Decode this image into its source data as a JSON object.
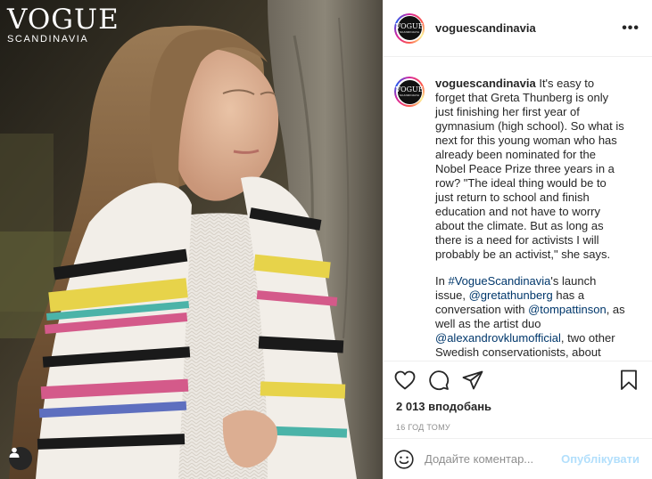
{
  "photo": {
    "logo": {
      "word": "VOGUE",
      "sub": "SCANDINAVIA"
    },
    "user_tag_icon": "user-silhouette-icon"
  },
  "header": {
    "username": "voguescandinavia",
    "more_icon": "ellipsis-icon",
    "more_label": "•••",
    "avatar": {
      "big": "VOGUE",
      "small": "SCANDINAVIA"
    }
  },
  "caption": {
    "username": "voguescandinavia",
    "paragraph1": " It's easy to forget that Greta Thunberg is only just finishing her first year of gymnasium (high school). So what is next for this young woman who has already been nominated for the Nobel Peace Prize three years in a row? \"The ideal thing would be to just return to school and finish education and not have to worry about the climate. But as long as there is a need for activists I will probably be an activist,\" she says.",
    "p2_intro": "In ",
    "p2_hashtag": "#VogueScandinavia",
    "p2_a": "'s launch issue, ",
    "p2_mention1": "@gretathunberg",
    "p2_b": " has a conversation with ",
    "p2_mention2": "@tompattinson",
    "p2_c": ", as well as the artist duo ",
    "p2_mention3": "@alexandrovklumofficial",
    "p2_d": ", two other Swedish conservationists, about their shared vision of a sustainable future. Read the full"
  },
  "actions": {
    "like_icon": "heart-icon",
    "comment_icon": "comment-bubble-icon",
    "share_icon": "paper-plane-icon",
    "save_icon": "bookmark-icon"
  },
  "likes": "2 013 вподобань",
  "timestamp": "16 ГОД ТОМУ",
  "comment": {
    "emoji_icon": "smiley-icon",
    "placeholder": "Додайте коментар...",
    "value": "",
    "publish_label": "Опублікувати"
  },
  "colors": {
    "link": "#00376b",
    "publish_disabled": "#b2dffc",
    "muted": "#8e8e8e"
  }
}
